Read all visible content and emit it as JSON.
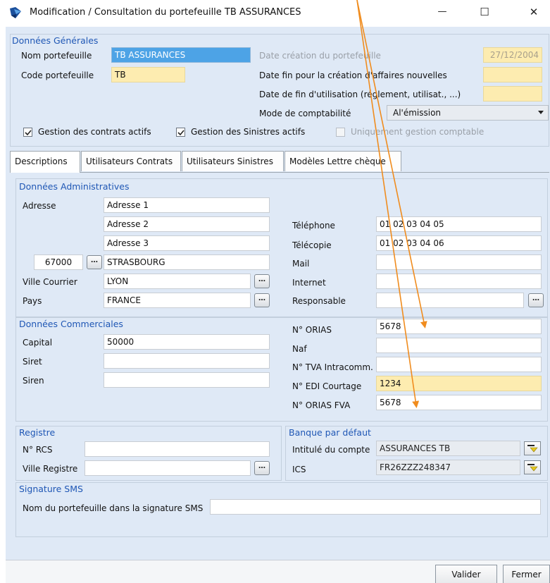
{
  "window": {
    "title": "Modification / Consultation du portefeuille TB ASSURANCES",
    "minimize": "—",
    "maximize": "☐",
    "close": "✕"
  },
  "general": {
    "section_title": "Données Générales",
    "nom_label": "Nom portefeuille",
    "nom_value": "TB ASSURANCES",
    "code_label": "Code portefeuille",
    "code_value": "TB",
    "date_creation_label": "Date création du portefeuille",
    "date_creation_value": "27/12/2004",
    "date_fin_creation_label": "Date fin pour la création d'affaires nouvelles",
    "date_fin_creation_value": "",
    "date_fin_util_label": "Date de fin d'utilisation (réglement, utilisat., ...)",
    "date_fin_util_value": "",
    "mode_label": "Mode de comptabilité",
    "mode_value": "Al'émission",
    "chk_contrats_label": "Gestion des contrats actifs",
    "chk_contrats_checked": true,
    "chk_sinistres_label": "Gestion des Sinistres actifs",
    "chk_sinistres_checked": true,
    "chk_compta_label": "Uniquement gestion comptable",
    "chk_compta_checked": false
  },
  "tabs": [
    {
      "label": "Descriptions"
    },
    {
      "label": "Utilisateurs Contrats"
    },
    {
      "label": "Utilisateurs Sinistres"
    },
    {
      "label": "Modèles Lettre chèque"
    }
  ],
  "admin": {
    "section_title": "Données Administratives",
    "adresse_label": "Adresse",
    "adresse1": "Adresse 1",
    "adresse2": "Adresse 2",
    "adresse3": "Adresse 3",
    "cp": "67000",
    "ville": "STRASBOURG",
    "ville_courrier_label": "Ville Courrier",
    "ville_courrier": "LYON",
    "pays_label": "Pays",
    "pays": "FRANCE",
    "telephone_label": "Téléphone",
    "telephone": "01 02 03 04 05",
    "telecopie_label": "Télécopie",
    "telecopie": "01 02 03 04 06",
    "mail_label": "Mail",
    "mail": "",
    "internet_label": "Internet",
    "internet": "",
    "responsable_label": "Responsable",
    "responsable": ""
  },
  "commercial": {
    "section_title": "Données Commerciales",
    "capital_label": "Capital",
    "capital": "50000",
    "siret_label": "Siret",
    "siret": "",
    "siren_label": "Siren",
    "siren": "",
    "orias_label": "N° ORIAS",
    "orias": "5678",
    "naf_label": "Naf",
    "naf": "",
    "tva_label": "N° TVA Intracomm.",
    "tva": "",
    "edi_label": "N° EDI Courtage",
    "edi": "1234",
    "orias_fva_label": "N° ORIAS FVA",
    "orias_fva": "5678"
  },
  "registre": {
    "section_title": "Registre",
    "rcs_label": "N° RCS",
    "rcs": "",
    "ville_label": "Ville Registre",
    "ville": ""
  },
  "banque": {
    "section_title": "Banque par défaut",
    "intitule_label": "Intitulé du compte",
    "intitule": "ASSURANCES TB",
    "ics_label": "ICS",
    "ics": "FR26ZZZ248347"
  },
  "sms": {
    "section_title": "Signature SMS",
    "nom_label": "Nom du portefeuille dans la signature SMS",
    "nom": ""
  },
  "footer": {
    "valider": "Valider",
    "fermer": "Fermer"
  },
  "colors": {
    "section_title": "#1f57b5",
    "panel_bg": "#dfe9f6",
    "yellow_field": "#fdecb0",
    "selection": "#4da3e6",
    "annotation_arrow": "#f08c1e"
  }
}
